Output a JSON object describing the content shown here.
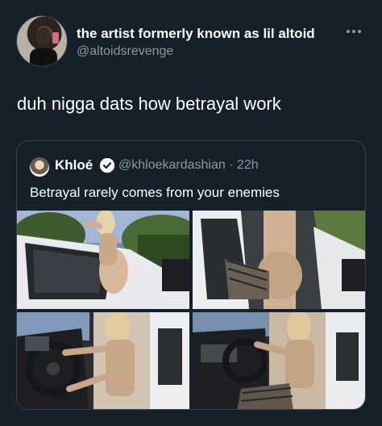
{
  "author": {
    "display_name": "the artist formerly known as lil altoid",
    "handle": "@altoidsrevenge"
  },
  "tweet": {
    "text": "duh nigga dats how betrayal work"
  },
  "quoted": {
    "name": "Khloé",
    "meta": "@khloekardashian · 22h",
    "text": "Betrayal rarely comes from your enemies"
  },
  "icons": {
    "more": "more-horizontal-icon",
    "verified": "verified-badge-icon"
  },
  "colors": {
    "background": "#15202b",
    "secondary_text": "#8b98a5",
    "border": "#38444d"
  }
}
